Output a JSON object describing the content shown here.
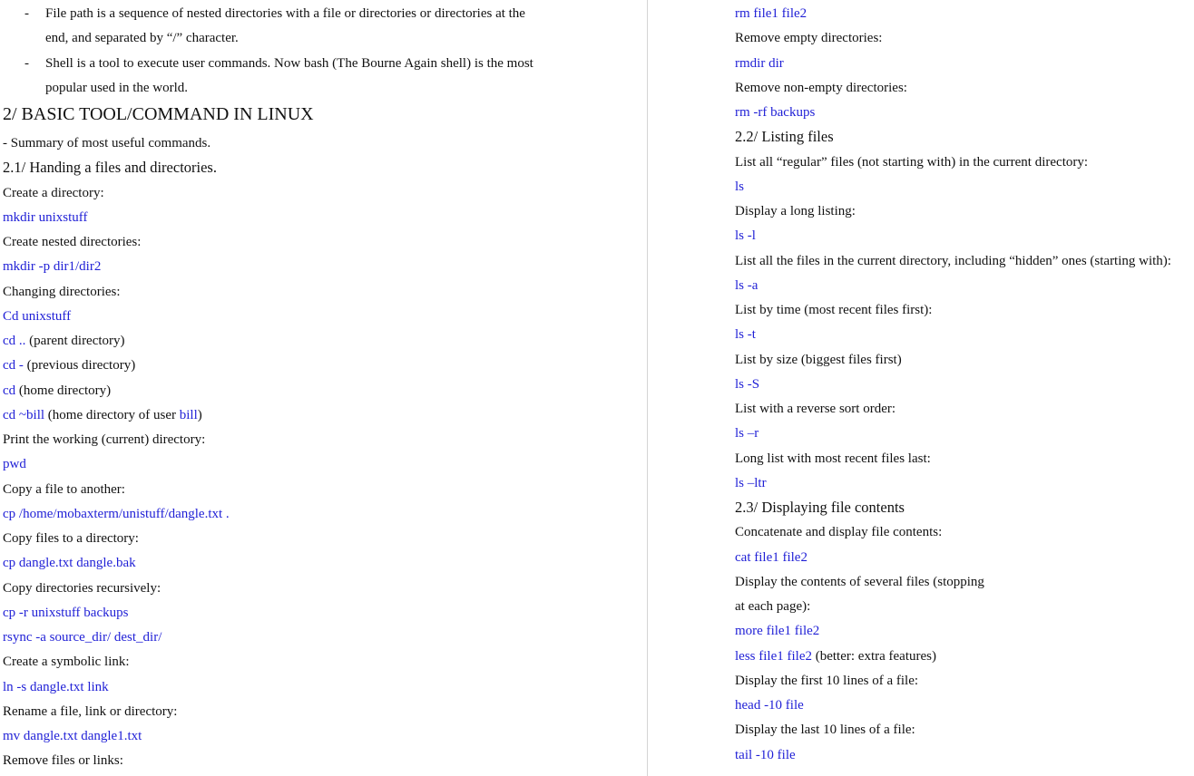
{
  "left": {
    "bullets": [
      {
        "lines": [
          "File path is a sequence of nested directories with a file or directories or directories at the",
          "end, and separated by “/” character."
        ]
      },
      {
        "lines": [
          "Shell is a tool to execute user commands. Now bash (The Bourne Again shell) is the most",
          "popular used in the world."
        ]
      }
    ],
    "heading": "2/ BASIC TOOL/COMMAND IN LINUX",
    "lines": [
      {
        "t": "- Summary of most useful commands."
      },
      {
        "t": "2.1/ Handing a files and directories.",
        "k": "h2"
      },
      {
        "t": "Create a directory:"
      },
      {
        "t": "mkdir unixstuff",
        "k": "cmd"
      },
      {
        "t": "Create nested directories:"
      },
      {
        "t": "mkdir -p dir1/dir2",
        "k": "cmd"
      },
      {
        "t": "Changing directories:"
      },
      {
        "t": "Cd unixstuff",
        "k": "cmd"
      },
      {
        "p": [
          {
            "t": "cd ..",
            "c": 1
          },
          {
            "t": " (parent directory)"
          }
        ]
      },
      {
        "p": [
          {
            "t": "cd -",
            "c": 1
          },
          {
            "t": " (previous directory)"
          }
        ]
      },
      {
        "p": [
          {
            "t": "cd",
            "c": 1
          },
          {
            "t": " (home directory)"
          }
        ]
      },
      {
        "p": [
          {
            "t": "cd ~bill",
            "c": 1
          },
          {
            "t": " (home directory of user "
          },
          {
            "t": "bill",
            "c": 1
          },
          {
            "t": ")"
          }
        ]
      },
      {
        "t": "Print the working (current) directory:"
      },
      {
        "t": "pwd",
        "k": "cmd"
      },
      {
        "t": "Copy a file to another:"
      },
      {
        "t": "cp /home/mobaxterm/unistuff/dangle.txt .",
        "k": "cmd"
      },
      {
        "t": "Copy files to a directory:"
      },
      {
        "t": "cp dangle.txt dangle.bak",
        "k": "cmd"
      },
      {
        "t": "Copy directories recursively:"
      },
      {
        "t": "cp -r unixstuff backups",
        "k": "cmd"
      },
      {
        "t": "rsync -a source_dir/ dest_dir/",
        "k": "cmd"
      },
      {
        "t": "Create a symbolic link:"
      },
      {
        "t": "ln -s dangle.txt link",
        "k": "cmd"
      },
      {
        "t": "Rename a file, link or directory:"
      },
      {
        "t": "mv dangle.txt dangle1.txt",
        "k": "cmd"
      },
      {
        "t": "Remove files or links:"
      }
    ]
  },
  "right": {
    "lines": [
      {
        "t": "rm file1 file2",
        "k": "cmd"
      },
      {
        "t": "Remove empty directories:"
      },
      {
        "t": "rmdir dir",
        "k": "cmd"
      },
      {
        "t": "Remove non-empty directories:"
      },
      {
        "t": "rm -rf backups",
        "k": "cmd"
      },
      {
        "t": "2.2/ Listing files",
        "k": "h2"
      },
      {
        "t": "List all “regular” files (not starting with) in the current directory:"
      },
      {
        "t": "ls",
        "k": "cmd"
      },
      {
        "t": "Display a long listing:"
      },
      {
        "t": "ls -l",
        "k": "cmd"
      },
      {
        "t": "List all the files in the current directory, including “hidden” ones (starting with):"
      },
      {
        "t": "ls -a",
        "k": "cmd"
      },
      {
        "t": "List by time (most recent files first):"
      },
      {
        "t": "ls -t",
        "k": "cmd"
      },
      {
        "t": "List by size (biggest files first)"
      },
      {
        "t": "ls -S",
        "k": "cmd"
      },
      {
        "t": "List with a reverse sort order:"
      },
      {
        "t": "ls –r",
        "k": "cmd"
      },
      {
        "t": "Long list with most recent files last:"
      },
      {
        "t": "ls –ltr",
        "k": "cmd"
      },
      {
        "t": "2.3/ Displaying file contents",
        "k": "h2"
      },
      {
        "t": "Concatenate and display file contents:"
      },
      {
        "t": "cat file1 file2",
        "k": "cmd"
      },
      {
        "t": "Display the contents of several files (stopping"
      },
      {
        "t": "at each page):"
      },
      {
        "t": "more file1 file2",
        "k": "cmd"
      },
      {
        "p": [
          {
            "t": "less file1 file2",
            "c": 1
          },
          {
            "t": " (better: extra features)"
          }
        ]
      },
      {
        "t": "Display the first 10 lines of a file:"
      },
      {
        "t": "head -10 file",
        "k": "cmd"
      },
      {
        "t": "Display the last 10 lines of a file:"
      },
      {
        "t": "tail -10 file",
        "k": "cmd"
      }
    ]
  }
}
